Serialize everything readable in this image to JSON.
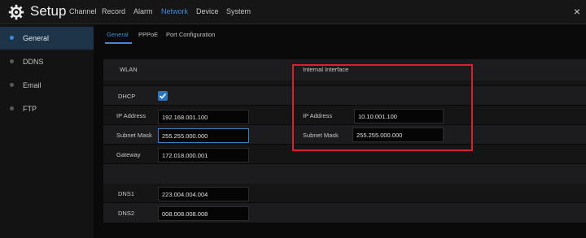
{
  "window": {
    "title": "Setup",
    "close_symbol": "×",
    "nav_tabs": [
      {
        "label": "Channel",
        "active": false
      },
      {
        "label": "Record",
        "active": false
      },
      {
        "label": "Alarm",
        "active": false
      },
      {
        "label": "Network",
        "active": true
      },
      {
        "label": "Device",
        "active": false
      },
      {
        "label": "System",
        "active": false
      }
    ]
  },
  "sidebar": {
    "items": [
      {
        "label": "General",
        "active": true
      },
      {
        "label": "DDNS",
        "active": false
      },
      {
        "label": "Email",
        "active": false
      },
      {
        "label": "FTP",
        "active": false
      }
    ]
  },
  "subtabs": [
    {
      "label": "General",
      "active": true
    },
    {
      "label": "PPPoE",
      "active": false
    },
    {
      "label": "Port Configuration",
      "active": false
    }
  ],
  "wlan": {
    "header": "WLAN",
    "dhcp_label": "DHCP",
    "dhcp_checked": true,
    "ip_label": "IP Address",
    "ip_value": "192.168.001.100",
    "mask_label": "Subnet Mask",
    "mask_value": "255.255.000.000",
    "gateway_label": "Gateway",
    "gateway_value": "172.018.000.001",
    "dns1_label": "DNS1",
    "dns1_value": "223.004.004.004",
    "dns2_label": "DNS2",
    "dns2_value": "008.008.008.008"
  },
  "internal": {
    "header": "Internal Interface",
    "ip_label": "IP Address",
    "ip_value": "10.10.001.100",
    "mask_label": "Subnet Mask",
    "mask_value": "255.255.000.000"
  },
  "colors": {
    "accent": "#3f8bd8",
    "highlight_box": "#d8212c",
    "background": "#0a0a0b"
  },
  "icons": [
    "gear-icon",
    "close-icon",
    "checkmark-icon",
    "bullet-icon"
  ]
}
